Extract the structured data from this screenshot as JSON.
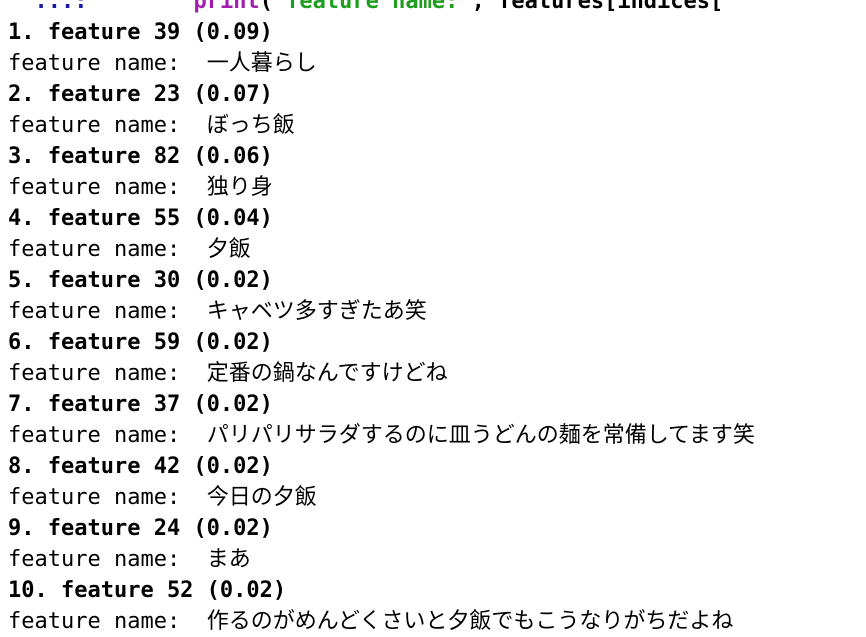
{
  "code_line": {
    "prompt": "  ...:",
    "func": "print",
    "open": "(",
    "string": "\"feature name:\"",
    "rest": ", features[indices["
  },
  "name_prefix": "feature name:  ",
  "results": [
    {
      "rank_line": "1. feature 39 (0.09)",
      "name": "一人暮らし"
    },
    {
      "rank_line": "2. feature 23 (0.07)",
      "name": "ぼっち飯"
    },
    {
      "rank_line": "3. feature 82 (0.06)",
      "name": "独り身"
    },
    {
      "rank_line": "4. feature 55 (0.04)",
      "name": "夕飯"
    },
    {
      "rank_line": "5. feature 30 (0.02)",
      "name": "キャベツ多すぎたあ笑"
    },
    {
      "rank_line": "6. feature 59 (0.02)",
      "name": "定番の鍋なんですけどね"
    },
    {
      "rank_line": "7. feature 37 (0.02)",
      "name": "パリパリサラダするのに皿うどんの麺を常備してます笑"
    },
    {
      "rank_line": "8. feature 42 (0.02)",
      "name": "今日の夕飯"
    },
    {
      "rank_line": "9. feature 24 (0.02)",
      "name": "まあ"
    },
    {
      "rank_line": "10. feature 52 (0.02)",
      "name": "作るのがめんどくさいと夕飯でもこうなりがちだよね"
    }
  ]
}
